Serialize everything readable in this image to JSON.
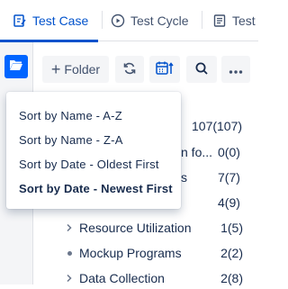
{
  "tabs": [
    {
      "label": "Test Case",
      "icon": "test-case-icon",
      "active": true
    },
    {
      "label": "Test Cycle",
      "icon": "test-cycle-icon",
      "active": false
    },
    {
      "label": "Test",
      "icon": "test-plan-icon",
      "active": false
    }
  ],
  "toolbar": {
    "add_folder_label": "Folder",
    "refresh_icon": "refresh-icon",
    "sort_icon": "calendar-sort-icon",
    "search_icon": "search-icon",
    "more_icon": "more-icon"
  },
  "sidebar": {
    "folder_toggle_icon": "folder-open-icon"
  },
  "sort_menu": {
    "items": [
      {
        "label": "Sort by Name - A-Z",
        "selected": false
      },
      {
        "label": "Sort by Name - Z-A",
        "selected": false
      },
      {
        "label": "Sort by Date - Oldest First",
        "selected": false
      },
      {
        "label": "Sort by Date - Newest First",
        "selected": true
      }
    ]
  },
  "tree": {
    "hidden_rows": [
      {
        "partial_label": "",
        "count": "107(107)"
      },
      {
        "partial_label": "n fo...",
        "count": "0(0)"
      },
      {
        "partial_label": "s",
        "count": "7(7)"
      },
      {
        "partial_label": "",
        "count": "4(9)"
      }
    ],
    "rows": [
      {
        "label": "Resource Utilization",
        "count": "1(5)",
        "marker": "chevron"
      },
      {
        "label": "Mockup Programs",
        "count": "2(2)",
        "marker": "bullet"
      },
      {
        "label": "Data Collection",
        "count": "2(8)",
        "marker": "chevron"
      }
    ]
  },
  "colors": {
    "accent": "#0052cc",
    "toggle": "#0065ff"
  }
}
